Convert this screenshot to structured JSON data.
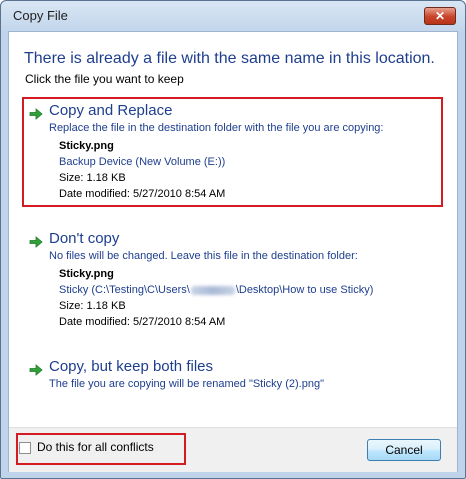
{
  "window": {
    "title": "Copy File",
    "close_glyph": "✕"
  },
  "heading": "There is already a file with the same name in this location.",
  "subheading": "Click the file you want to keep",
  "options": [
    {
      "title": "Copy and Replace",
      "description": "Replace the file in the destination folder with the file you are copying:",
      "file_name": "Sticky.png",
      "location": "Backup Device (New Volume (E:))",
      "size": "Size: 1.18 KB",
      "date": "Date modified: 5/27/2010 8:54 AM",
      "icon": "green-arrow-icon"
    },
    {
      "title": "Don't copy",
      "description": "No files will be changed. Leave this file in the destination folder:",
      "file_name": "Sticky.png",
      "location_prefix": "Sticky (C:\\Testing\\C\\Users\\",
      "location_suffix": "\\Desktop\\How to use Sticky)",
      "size": "Size: 1.18 KB",
      "date": "Date modified: 5/27/2010 8:54 AM",
      "icon": "green-arrow-icon"
    },
    {
      "title": "Copy, but keep both files",
      "description": "The file you are copying will be renamed \"Sticky (2).png\"",
      "icon": "green-arrow-icon"
    }
  ],
  "footer": {
    "checkbox_label": "Do this for all conflicts",
    "checkbox_checked": false,
    "cancel_label": "Cancel"
  },
  "colors": {
    "link_blue": "#1e3e8e",
    "arrow_green": "#2fa33a",
    "highlight_red": "#d31b24"
  }
}
